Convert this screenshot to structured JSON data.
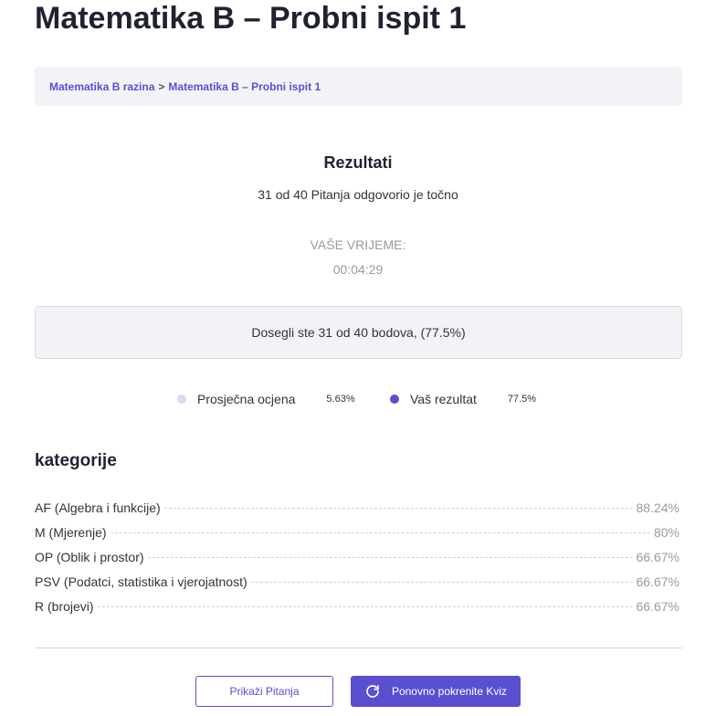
{
  "page": {
    "title": "Matematika B – Probni ispit 1"
  },
  "breadcrumb": {
    "items": [
      {
        "label": "Matematika B razina"
      },
      {
        "label": "Matematika B – Probni ispit 1"
      }
    ],
    "separator": ">"
  },
  "results": {
    "title": "Rezultati",
    "correct_text": "31 od 40 Pitanja odgovorio je točno",
    "time_label": "VAŠE VRIJEME:",
    "time_value": "00:04:29",
    "score_text": "Dosegli ste 31 od 40 bodova, (77.5%)"
  },
  "legend": {
    "items": [
      {
        "label": "Prosječna ocjena",
        "value": "5.63%",
        "color": "#e2d3f7"
      },
      {
        "label": "Vaš rezultat",
        "value": "77.5%",
        "color": "#5a4fcf"
      }
    ]
  },
  "categories": {
    "title": "kategorije",
    "items": [
      {
        "name": "AF (Algebra i funkcije)",
        "value": "88.24%"
      },
      {
        "name": "M (Mjerenje)",
        "value": "80%"
      },
      {
        "name": "OP (Oblik i prostor)",
        "value": "66.67%"
      },
      {
        "name": "PSV (Podatci, statistika i vjerojatnost)",
        "value": "66.67%"
      },
      {
        "name": "R (brojevi)",
        "value": "66.67%"
      }
    ]
  },
  "buttons": {
    "show_questions": "Prikaži Pitanja",
    "restart_quiz": "Ponovno pokrenite Kviz",
    "restart_icon": "refresh-icon"
  },
  "colors": {
    "accent": "#5a4fcf",
    "legend_average": "#e2d3f7"
  }
}
